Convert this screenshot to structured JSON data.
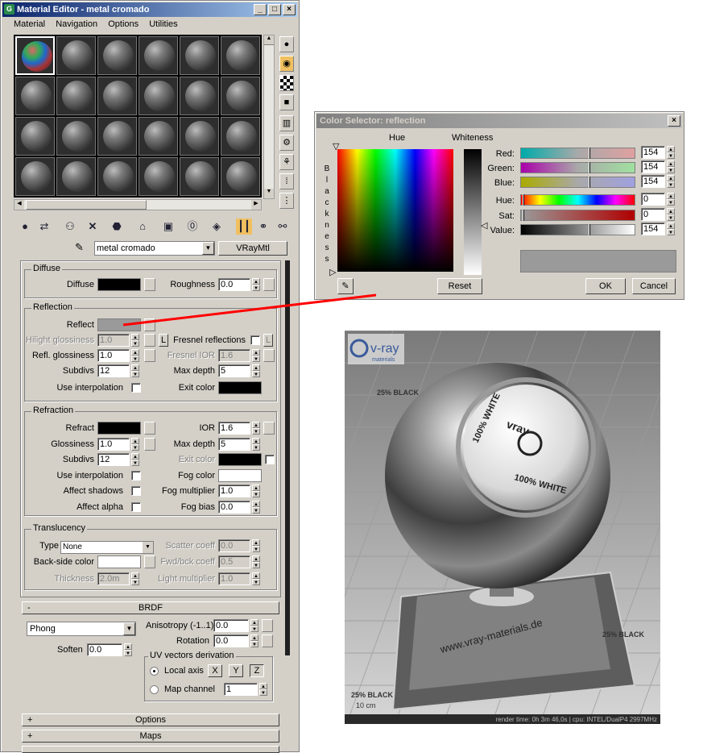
{
  "material_editor": {
    "title": "Material Editor - metal cromado",
    "menu": [
      "Material",
      "Navigation",
      "Options",
      "Utilities"
    ],
    "material_name": "metal cromado",
    "material_type": "VRayMtl",
    "diffuse": {
      "group": "Diffuse",
      "diffuse_label": "Diffuse",
      "diffuse_color": "#000000",
      "roughness_label": "Roughness",
      "roughness_value": "0.0"
    },
    "reflection": {
      "group": "Reflection",
      "reflect_label": "Reflect",
      "reflect_color": "#9a9a9a",
      "hilight_label": "Hilight glossiness",
      "hilight_value": "1.0",
      "lock_label": "L",
      "refl_gloss_label": "Refl. glossiness",
      "refl_gloss_value": "1.0",
      "subdivs_label": "Subdivs",
      "subdivs_value": "12",
      "use_interp_label": "Use interpolation",
      "fresnel_label": "Fresnel reflections",
      "fresnel_lock": "L",
      "fresnel_ior_label": "Fresnel IOR",
      "fresnel_ior_value": "1.6",
      "max_depth_label": "Max depth",
      "max_depth_value": "5",
      "exit_color_label": "Exit color",
      "exit_color": "#000000"
    },
    "refraction": {
      "group": "Refraction",
      "refract_label": "Refract",
      "refract_color": "#000000",
      "gloss_label": "Glossiness",
      "gloss_value": "1.0",
      "subdivs_label": "Subdivs",
      "subdivs_value": "12",
      "use_interp_label": "Use interpolation",
      "affect_shadows_label": "Affect shadows",
      "affect_alpha_label": "Affect alpha",
      "ior_label": "IOR",
      "ior_value": "1.6",
      "max_depth_label": "Max depth",
      "max_depth_value": "5",
      "exit_color_label": "Exit color",
      "exit_color": "#000000",
      "fog_color_label": "Fog color",
      "fog_color": "#ffffff",
      "fog_mult_label": "Fog multiplier",
      "fog_mult_value": "1.0",
      "fog_bias_label": "Fog bias",
      "fog_bias_value": "0.0"
    },
    "translucency": {
      "group": "Translucency",
      "type_label": "Type",
      "type_value": "None",
      "backside_label": "Back-side color",
      "backside_color": "#ffffff",
      "thickness_label": "Thickness",
      "thickness_value": "2.0m",
      "scatter_label": "Scatter coeff",
      "scatter_value": "0.0",
      "fwdbck_label": "Fwd/bck coeff",
      "fwdbck_value": "0.5",
      "light_mult_label": "Light multiplier",
      "light_mult_value": "1.0"
    },
    "brdf": {
      "header": "BRDF",
      "toggle": "-",
      "type_value": "Phong",
      "soften_label": "Soften",
      "soften_value": "0.0",
      "aniso_label": "Anisotropy (-1..1)",
      "aniso_value": "0.0",
      "rotation_label": "Rotation",
      "rotation_value": "0.0",
      "uv_group": "UV vectors derivation",
      "local_axis_label": "Local axis",
      "axis_x": "X",
      "axis_y": "Y",
      "axis_z": "Z",
      "map_channel_label": "Map channel",
      "map_channel_value": "1"
    },
    "options_header": "Options",
    "maps_header": "Maps",
    "plus": "+"
  },
  "color_selector": {
    "title": "Color Selector: reflection",
    "hue_label": "Hue",
    "whiteness_label": "Whiteness",
    "blackness_letters": [
      "B",
      "l",
      "a",
      "c",
      "k",
      "n",
      "e",
      "s",
      "s"
    ],
    "red_label": "Red:",
    "red_value": "154",
    "green_label": "Green:",
    "green_value": "154",
    "blue_label": "Blue:",
    "blue_value": "154",
    "hue_slider_label": "Hue:",
    "hue_value": "0",
    "sat_label": "Sat:",
    "sat_value": "0",
    "value_label": "Value:",
    "value_value": "154",
    "preview_color": "#9a9a9a",
    "reset_label": "Reset",
    "ok_label": "OK",
    "cancel_label": "Cancel"
  },
  "render": {
    "logo_text": "v-ray",
    "logo_sub": "materials",
    "ball_text_top": "100% WHITE",
    "ball_brand": "vray",
    "ball_text_bottom": "100% WHITE",
    "base_url": "www.vray-materials.de",
    "floor_label": "25% BLACK",
    "floor_sub": "10 cm",
    "status": "render time: 0h 3m 46,0s | cpu: INTEL/DualP4 2997MHz"
  },
  "accent_color": "#ff0000"
}
